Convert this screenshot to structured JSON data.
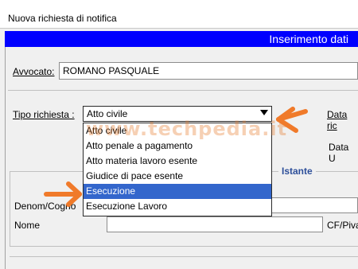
{
  "window": {
    "title": "Nuova richiesta di notifica"
  },
  "banner": {
    "text": "Inserimento dati",
    "color": "#0000ff"
  },
  "avvocato": {
    "label": "Avvocato:",
    "value": "ROMANO PASQUALE"
  },
  "tipo_richiesta": {
    "label": "Tipo richiesta :",
    "selected": "Atto civile",
    "options": [
      "Atto civile",
      "Atto penale a pagamento",
      "Atto materia lavoro esente",
      "Giudice di pace esente",
      "Esecuzione",
      "Esecuzione Lavoro"
    ],
    "highlighted_option": "Esecuzione",
    "highlight_color": "#3366cc"
  },
  "right_labels": {
    "data_ric": "Data ric",
    "data_u": "Data U"
  },
  "istante": {
    "title": "Istante",
    "denom_label": "Denom/Cogno",
    "nome_label": "Nome",
    "cf_label": "CF/Piva"
  },
  "watermark": {
    "text": "www.techpedia.it"
  },
  "annotations": {
    "arrow_color": "#f07a2a"
  }
}
